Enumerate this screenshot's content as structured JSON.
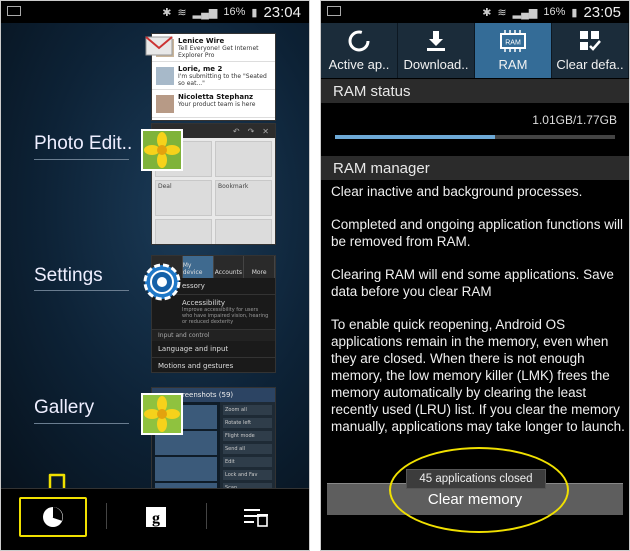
{
  "left_screen": {
    "status": {
      "battery": "16%",
      "time": "23:04"
    },
    "recent_apps": [
      {
        "label": "Photo Edit.."
      },
      {
        "label": "Settings"
      },
      {
        "label": "Gallery"
      }
    ],
    "email_preview": {
      "rows": [
        {
          "sender": "Lenice Wire",
          "line": "Tell Everyone! Get Internet Explorer Pro"
        },
        {
          "sender": "Lorie, me  2",
          "line": "I'm submitting to the \"Seated so eat...\""
        },
        {
          "sender": "Nicoletta Stephanz",
          "line": "Your product team is here"
        }
      ]
    },
    "photo_preview": {
      "left_tab": "Deal",
      "right_tab": "Bookmark"
    },
    "settings_preview": {
      "tabs": [
        "",
        "My device",
        "Accounts",
        "More"
      ],
      "rows": [
        {
          "title": "essory",
          "sub": ""
        },
        {
          "title": "Accessibility",
          "sub": "Improve accessibility for users who have impaired vision, hearing or reduced dexterity"
        }
      ],
      "section": "Input and control",
      "rows2": [
        {
          "title": "Language and input"
        },
        {
          "title": "Motions and gestures"
        }
      ]
    },
    "gallery_preview": {
      "title": "reenshots (59)",
      "menu": [
        "Zoom all",
        "Rotate left",
        "Flight mode",
        "Send all",
        "Edit",
        "Lock and Fav",
        "Scan"
      ]
    },
    "colors": {
      "highlight": "#f0e000"
    },
    "nav": {
      "task_icon": "pie-chart-icon",
      "google_icon": "google-icon",
      "clear_icon": "clear-all-icon"
    }
  },
  "right_screen": {
    "status": {
      "battery": "16%",
      "time": "23:05"
    },
    "tabs": [
      {
        "label": "Active ap..",
        "icon": "ring-icon"
      },
      {
        "label": "Download..",
        "icon": "download-icon"
      },
      {
        "label": "RAM",
        "icon": "ram-chip-icon",
        "chip_text": "RAM",
        "active": true
      },
      {
        "label": "Clear defa..",
        "icon": "grid-check-icon"
      }
    ],
    "ram_status": {
      "heading": "RAM status",
      "usage": "1.01GB/1.77GB",
      "fraction": 0.57
    },
    "ram_manager": {
      "heading": "RAM manager",
      "paragraphs": [
        "Clear inactive and background processes.",
        "Completed and ongoing application functions will be removed from RAM.",
        "Clearing RAM will end some applications. Save data before you clear RAM",
        "To enable quick reopening, Android OS applications remain in the memory, even when they are closed. When there is not enough memory, the low memory killer (LMK) frees the memory automatically by clearing the least recently used (LRU) list. If you clear the memory manually, applications may take longer to launch."
      ]
    },
    "toast": "45 applications closed",
    "clear_button": "Clear memory",
    "colors": {
      "active_tab": "#346c97",
      "bar_fill": "#6da9d6",
      "highlight": "#f0e000"
    }
  }
}
